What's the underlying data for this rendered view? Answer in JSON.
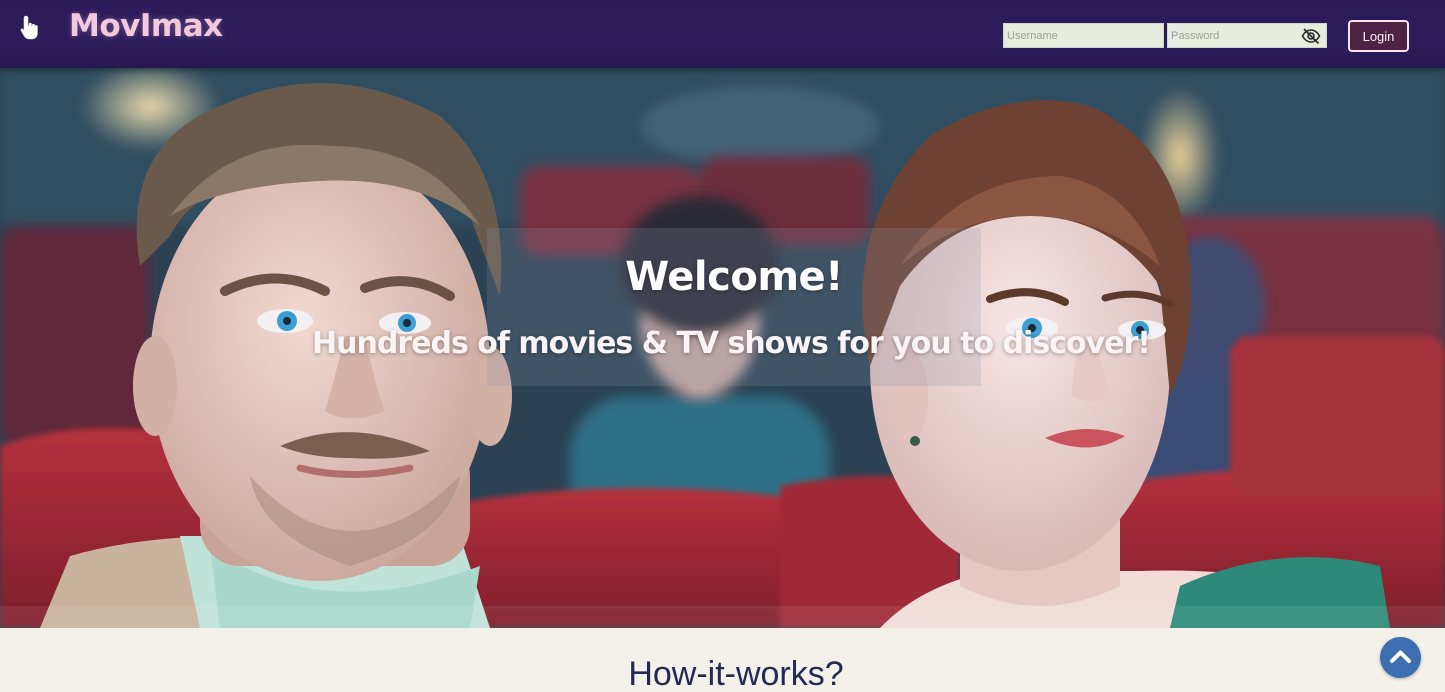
{
  "header": {
    "brand": "MovImax",
    "username_placeholder": "Username",
    "password_placeholder": "Password",
    "login_label": "Login"
  },
  "hero": {
    "title": "Welcome!",
    "subtitle": "Hundreds of movies & TV shows for you to discover!"
  },
  "section": {
    "heading": "How-it-works?"
  },
  "icons": {
    "menu": "hand-pointer-icon",
    "password_toggle": "eye-slash-icon",
    "scroll_top": "chevron-up-icon"
  },
  "colors": {
    "header_bg": "#2d1d5c",
    "brand": "#f3c9dd",
    "login_button_bg": "#4e2242",
    "scroll_button_bg": "#3d6fb0",
    "heading_text": "#232a52"
  }
}
